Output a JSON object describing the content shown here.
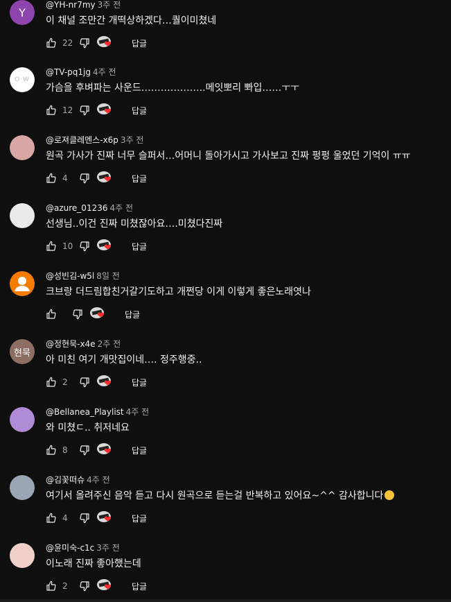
{
  "comments": [
    {
      "handle": "@YH-nr7my",
      "time": "3주 전",
      "text": "이 채널 조만간 개떡상하겠다…퀄이미쳤네",
      "likes": "22",
      "reply": "답글",
      "avatar": {
        "type": "letter",
        "letter": "Y",
        "color": "#8e44ad"
      }
    },
    {
      "handle": "@TV-pq1jg",
      "time": "4주 전",
      "text": "가슴을 후벼파는 사운드………………..메잇뽀리 뽜입……ㅜㅜ",
      "likes": "12",
      "reply": "답글",
      "avatar": {
        "type": "logo",
        "letter": "O·W",
        "color": "#ffffff"
      }
    },
    {
      "handle": "@로져클레멘스-x6p",
      "time": "3주 전",
      "text": "원곡 가사가 진짜 너무 슬퍼서…어머니 돌아가시고 가사보고 진짜 펑펑 울었던 기억이 ㅠㅠ",
      "likes": "4",
      "reply": "답글",
      "avatar": {
        "type": "photo",
        "color": "#d9a6a6"
      }
    },
    {
      "handle": "@azure_01236",
      "time": "4주 전",
      "text": "선생님..이건 진짜 미쳤잖아요….미쳤다진짜",
      "likes": "10",
      "reply": "답글",
      "avatar": {
        "type": "photo",
        "color": "#eaeaea"
      }
    },
    {
      "handle": "@성빈김-w5l",
      "time": "8일 전",
      "text": "크브랑 더드림합친거갈기도하고 개쩐당 이게 이렇게 좋은노래엿나",
      "likes": "",
      "reply": "답글",
      "avatar": {
        "type": "default",
        "color": "#f57c00"
      }
    },
    {
      "handle": "@정현묵-x4e",
      "time": "2주 전",
      "text": "아 미친 여기 개맛집이네…. 정주행중..",
      "likes": "2",
      "reply": "답글",
      "avatar": {
        "type": "letter",
        "letter": "현묵",
        "color": "#8d6e63"
      }
    },
    {
      "handle": "@Bellanea_Playlist",
      "time": "4주 전",
      "text": "와 미쳤ㄷ.. 취저네요",
      "likes": "8",
      "reply": "답글",
      "avatar": {
        "type": "photo",
        "color": "#b18bd6"
      }
    },
    {
      "handle": "@김꽃떠슈",
      "time": "4주 전",
      "text": "여기서 올려주신 음악 듣고 다시 원곡으로 듣는걸 반복하고 있어요~^^  감사합니다",
      "likes": "4",
      "reply": "답글",
      "avatar": {
        "type": "photo",
        "color": "#9aa6b5"
      }
    },
    {
      "handle": "@윤미숙-c1c",
      "time": "3주 전",
      "text": "이노래 진짜 좋아했는데",
      "likes": "2",
      "reply": "답글",
      "avatar": {
        "type": "photo",
        "color": "#f0d0c8"
      }
    }
  ]
}
